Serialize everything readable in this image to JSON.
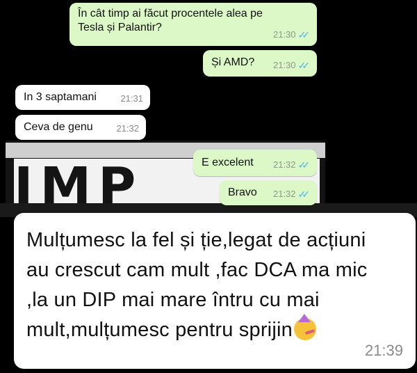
{
  "messages": [
    {
      "id": "b1",
      "direction": "outgoing",
      "text": "În cât timp ai făcut procentele alea pe Tesla și Palantir?",
      "time": "21:30",
      "status": "read"
    },
    {
      "id": "b2",
      "direction": "outgoing",
      "text": "Și AMD?",
      "time": "21:30",
      "status": "read"
    },
    {
      "id": "b3",
      "direction": "incoming",
      "text": "In 3 saptamani",
      "time": "21:31"
    },
    {
      "id": "b4",
      "direction": "incoming",
      "text": "Ceva de genu",
      "time": "21:32"
    },
    {
      "id": "b5",
      "direction": "outgoing",
      "text": "E excelent",
      "time": "21:32",
      "status": "read"
    },
    {
      "id": "b6",
      "direction": "outgoing",
      "text": "Bravo",
      "time": "21:32",
      "status": "read"
    },
    {
      "id": "b7",
      "direction": "incoming",
      "text": "Mulțumesc la fel și ție,legat de acțiuni au crescut cam mult ,fac DCA ma mic ,la un DIP mai mare întru cu mai mult,mulțumesc pentru sprijin",
      "time": "21:39",
      "emoji": "partying-face-emoji"
    }
  ],
  "background": {
    "sign_text": "IMP"
  },
  "colors": {
    "outgoing_bubble": "#dcf8c6",
    "incoming_bubble": "#ffffff",
    "read_ticks": "#4fb6ec",
    "background": "#000000"
  },
  "icons": {
    "read_receipt": "double-check-icon"
  }
}
